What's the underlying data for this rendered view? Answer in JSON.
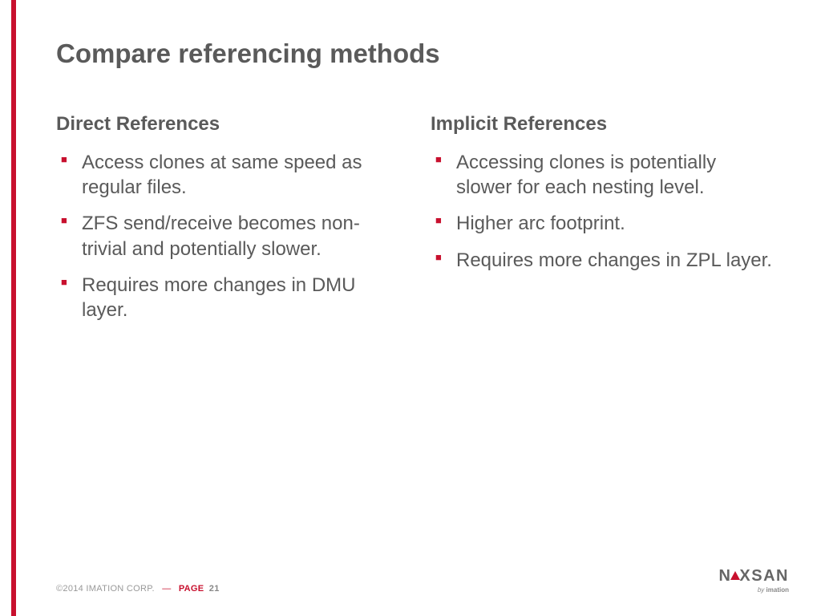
{
  "title": "Compare referencing methods",
  "left": {
    "heading": "Direct References",
    "items": [
      "Access clones at same speed as regular files.",
      "ZFS send/receive becomes non-trivial and potentially slower.",
      "Requires more changes in DMU layer."
    ]
  },
  "right": {
    "heading": "Implicit References",
    "items": [
      "Accessing clones is potentially slower for each nesting level.",
      "Higher arc footprint.",
      "Requires more changes in ZPL layer."
    ]
  },
  "footer": {
    "copyright": "©2014 IMATION CORP.",
    "dash": "—",
    "page_label": "PAGE",
    "page_number": "21"
  },
  "logo": {
    "prefix": "N",
    "suffix": "XSAN",
    "byline_by": "by",
    "byline_brand": "imation"
  }
}
